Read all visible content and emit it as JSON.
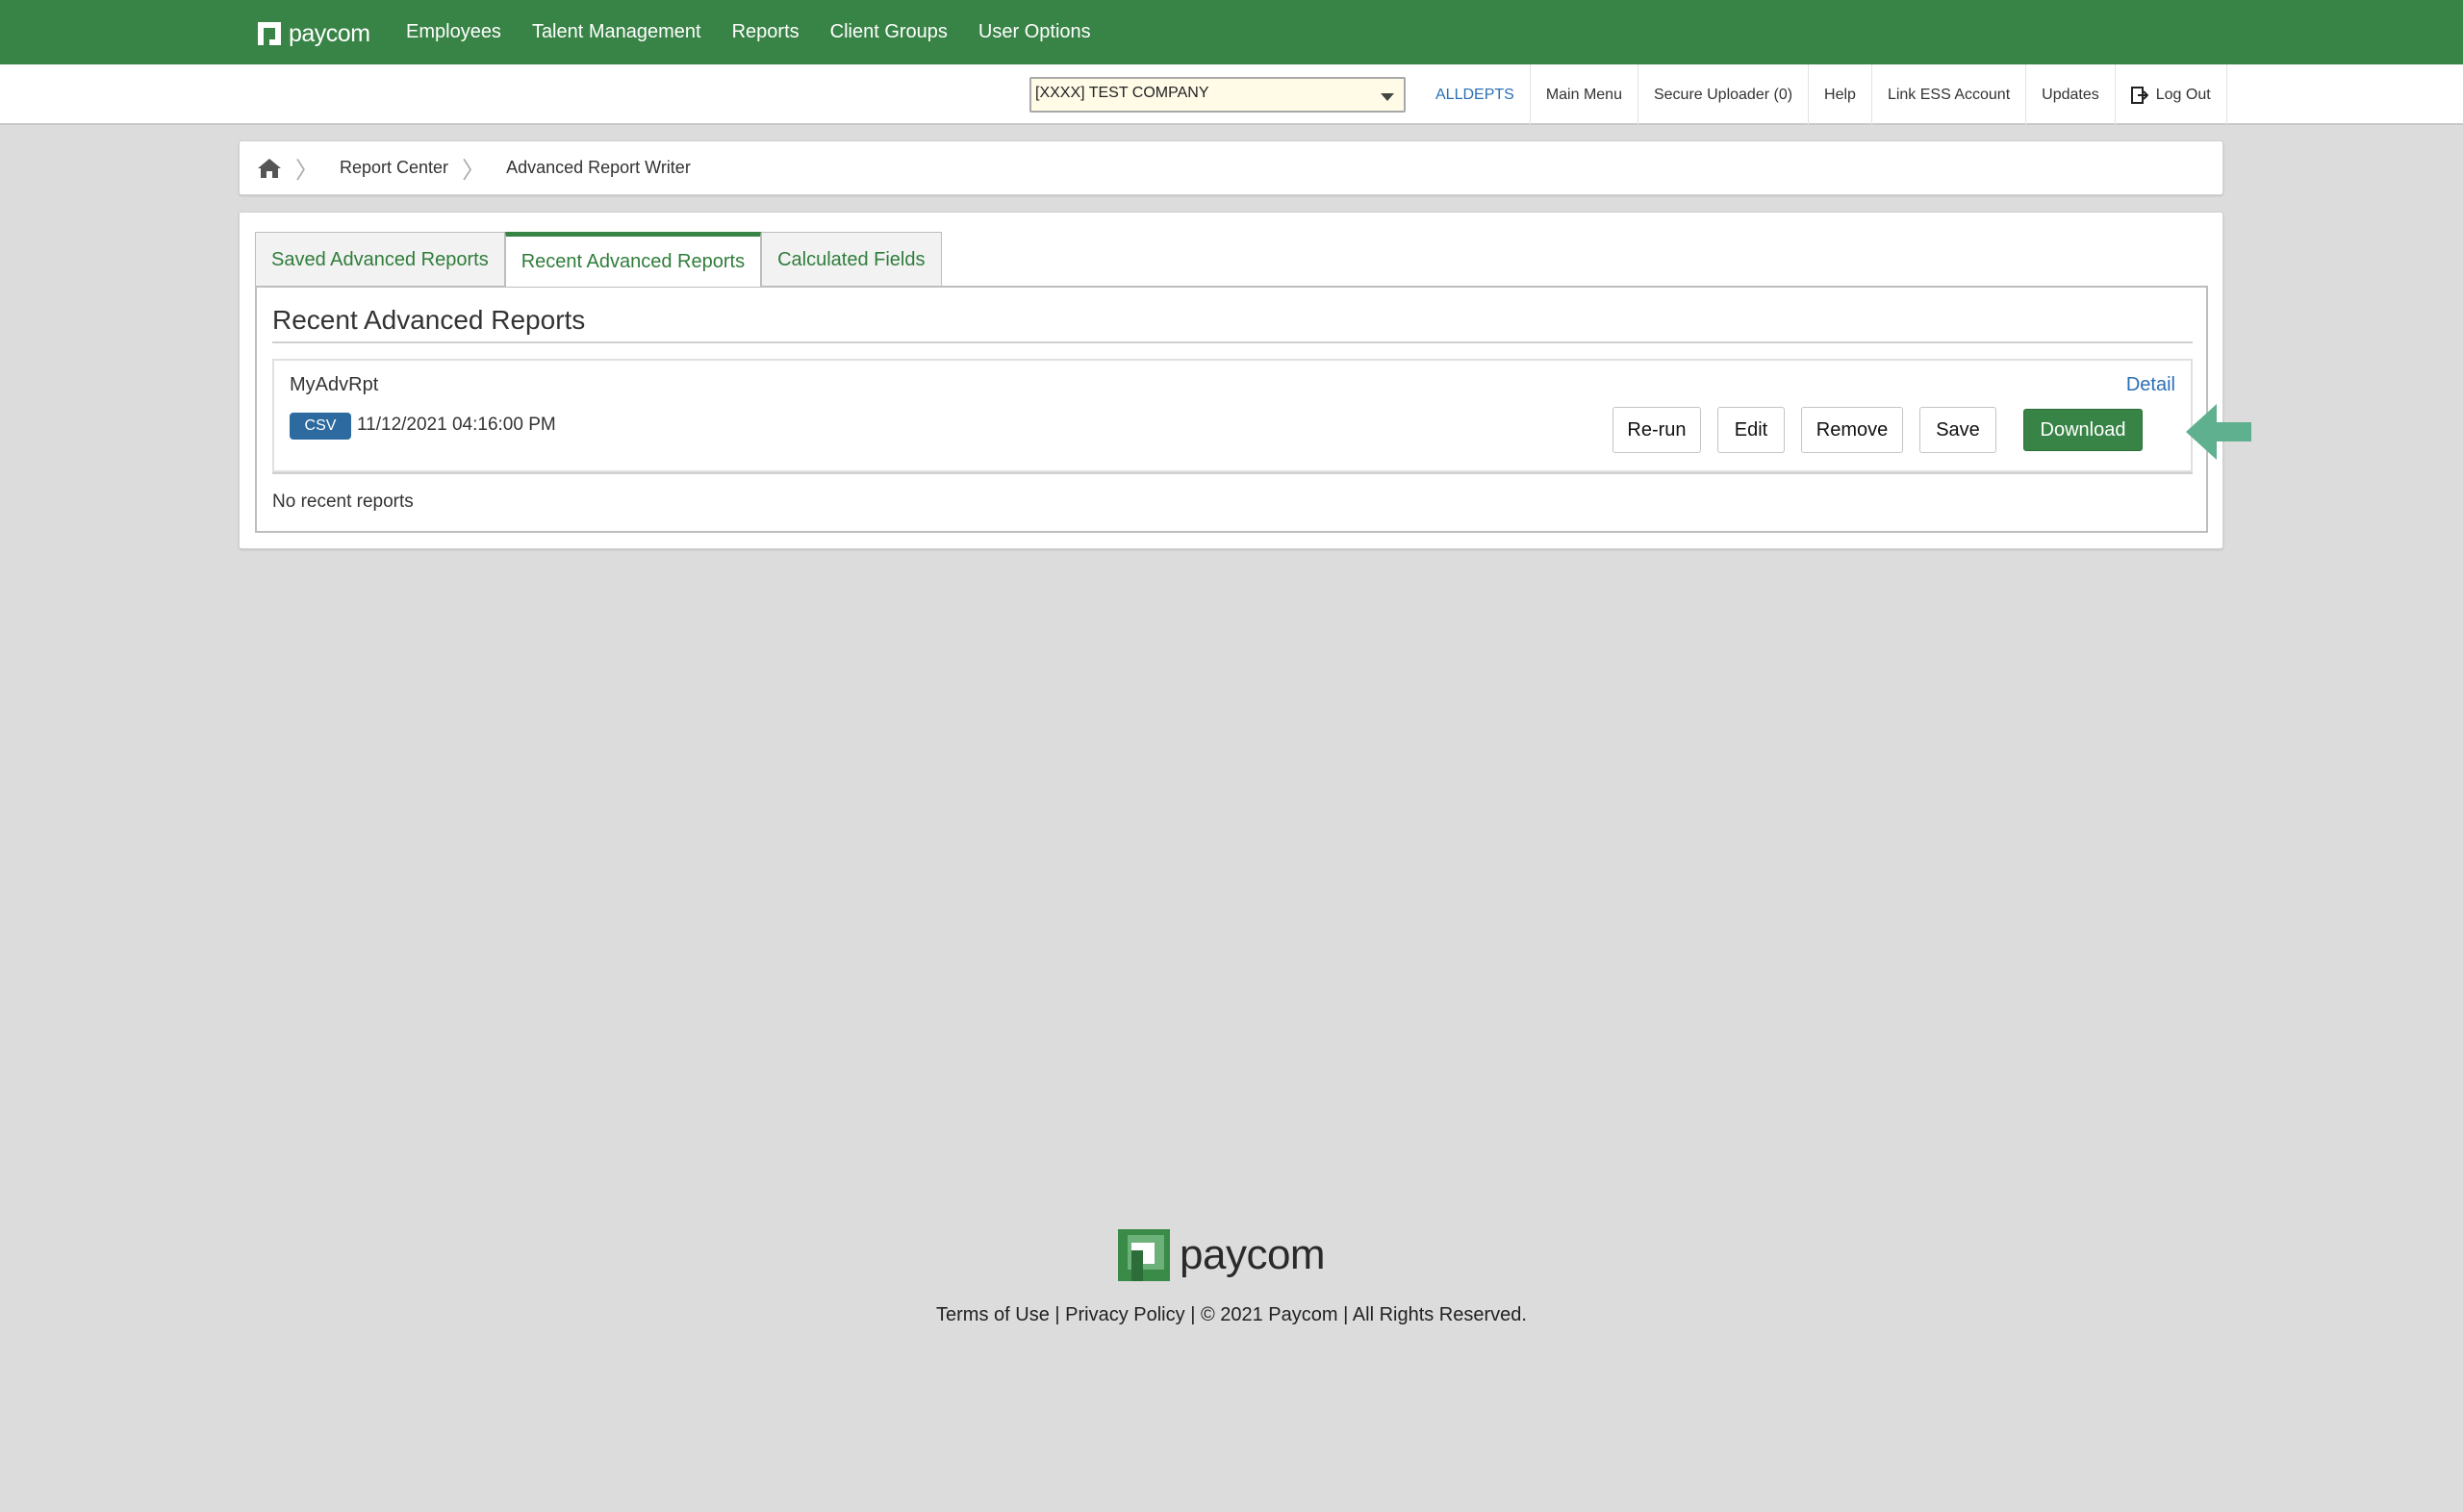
{
  "header": {
    "logo_text": "paycom",
    "nav": [
      "Employees",
      "Talent Management",
      "Reports",
      "Client Groups",
      "User Options"
    ],
    "brand_color": "#388346"
  },
  "subbar": {
    "company_select": "[XXXX] TEST COMPANY",
    "links": [
      "ALLDEPTS",
      "Main Menu",
      "Secure Uploader (0)",
      "Help",
      "Link ESS Account",
      "Updates"
    ],
    "logout_label": "Log Out"
  },
  "breadcrumb": {
    "items": [
      "Report Center",
      "Advanced Report Writer"
    ]
  },
  "tabs": [
    {
      "label": "Saved Advanced Reports",
      "active": false
    },
    {
      "label": "Recent Advanced Reports",
      "active": true
    },
    {
      "label": "Calculated Fields",
      "active": false
    }
  ],
  "main": {
    "title": "Recent Advanced Reports",
    "report": {
      "name": "MyAdvRpt",
      "format": "CSV",
      "date": "11/12/2021 04:16:00 PM",
      "detail_label": "Detail",
      "buttons": {
        "rerun": "Re-run",
        "edit": "Edit",
        "remove": "Remove",
        "save": "Save",
        "download": "Download"
      }
    },
    "empty_text": "No recent reports"
  },
  "footer": {
    "logo_text": "paycom",
    "terms": "Terms of Use",
    "privacy": "Privacy Policy",
    "copyright": "© 2021 Paycom",
    "rights": "All Rights Reserved."
  }
}
